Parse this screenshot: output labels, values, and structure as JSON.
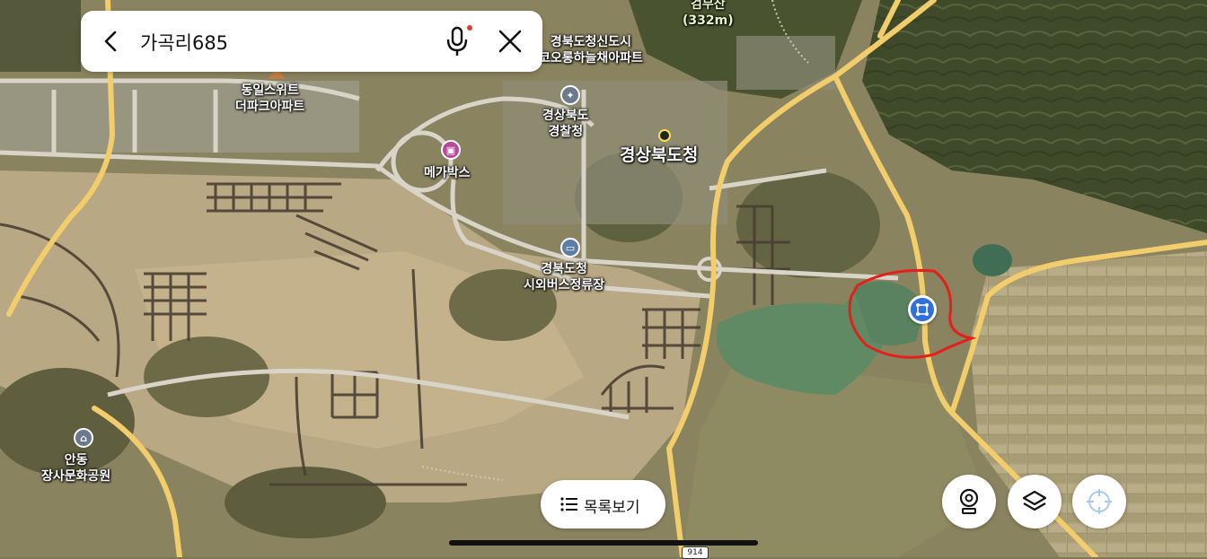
{
  "search": {
    "query": "가곡리685"
  },
  "map_labels": {
    "peak_name": "검무산",
    "peak_elevation": "(332m)",
    "apartment_1_line1": "경북도청신도시",
    "apartment_1_line2": "코오롱하늘채아파트",
    "apartment_2_line1": "동일스위트",
    "apartment_2_line2": "더파크아파트",
    "police_line1": "경상북도",
    "police_line2": "경찰청",
    "provincial_office": "경상북도청",
    "cinema": "메가박스",
    "bus_terminal_line1": "경북도청",
    "bus_terminal_line2": "시외버스정류장",
    "park_line1": "안동",
    "park_line2": "장사문화공원"
  },
  "road_shield": "914",
  "bottom": {
    "list_view_label": "목록보기"
  },
  "icons": {
    "back": "chevron-left-icon",
    "mic": "microphone-icon",
    "close": "close-icon",
    "list": "list-icon",
    "street_view": "street-view-icon",
    "layers": "layers-icon",
    "locate": "crosshair-icon",
    "marker": "location-marker-icon"
  },
  "colors": {
    "mic_dot": "#e53935",
    "marker": "#2f6fde",
    "annotation_circle": "#e3201b",
    "highway": "#f2cd6b",
    "locate_icon": "#a9c8ef"
  }
}
